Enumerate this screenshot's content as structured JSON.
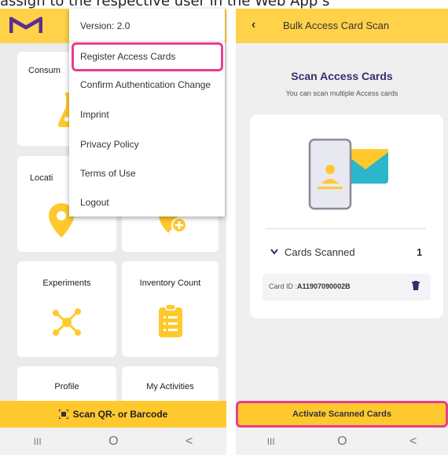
{
  "caption": "assign to the respective user in the Web App s",
  "left": {
    "tiles": {
      "consumables": "Consum",
      "locations": "Locati",
      "experiments": "Experiments",
      "inventory": "Inventory Count",
      "profile": "Profile",
      "activities": "My Activities"
    },
    "scan_button": "Scan QR- or Barcode",
    "menu": {
      "version": "Version: 2.0",
      "register": "Register Access Cards",
      "confirm": "Confirm Authentication Change",
      "imprint": "Imprint",
      "privacy": "Privacy Policy",
      "terms": "Terms of Use",
      "logout": "Logout"
    },
    "nav": {
      "recent": "III",
      "home": "O",
      "back": "<"
    }
  },
  "right": {
    "header_title": "Bulk Access Card Scan",
    "title": "Scan Access Cards",
    "subtitle": "You can scan multiple Access cards",
    "cards_scanned_label": "Cards Scanned",
    "cards_scanned_count": "1",
    "card_id_label": "Card ID :",
    "card_id_value": "A11907090002B",
    "activate_button": "Activate Scanned Cards",
    "nav": {
      "recent": "III",
      "home": "O",
      "back": "<"
    }
  },
  "colors": {
    "brand_yellow": "#ffd24a",
    "accent_yellow": "#ffc92e",
    "highlight_pink": "#e83e8c",
    "brand_purple": "#5c2d91"
  }
}
